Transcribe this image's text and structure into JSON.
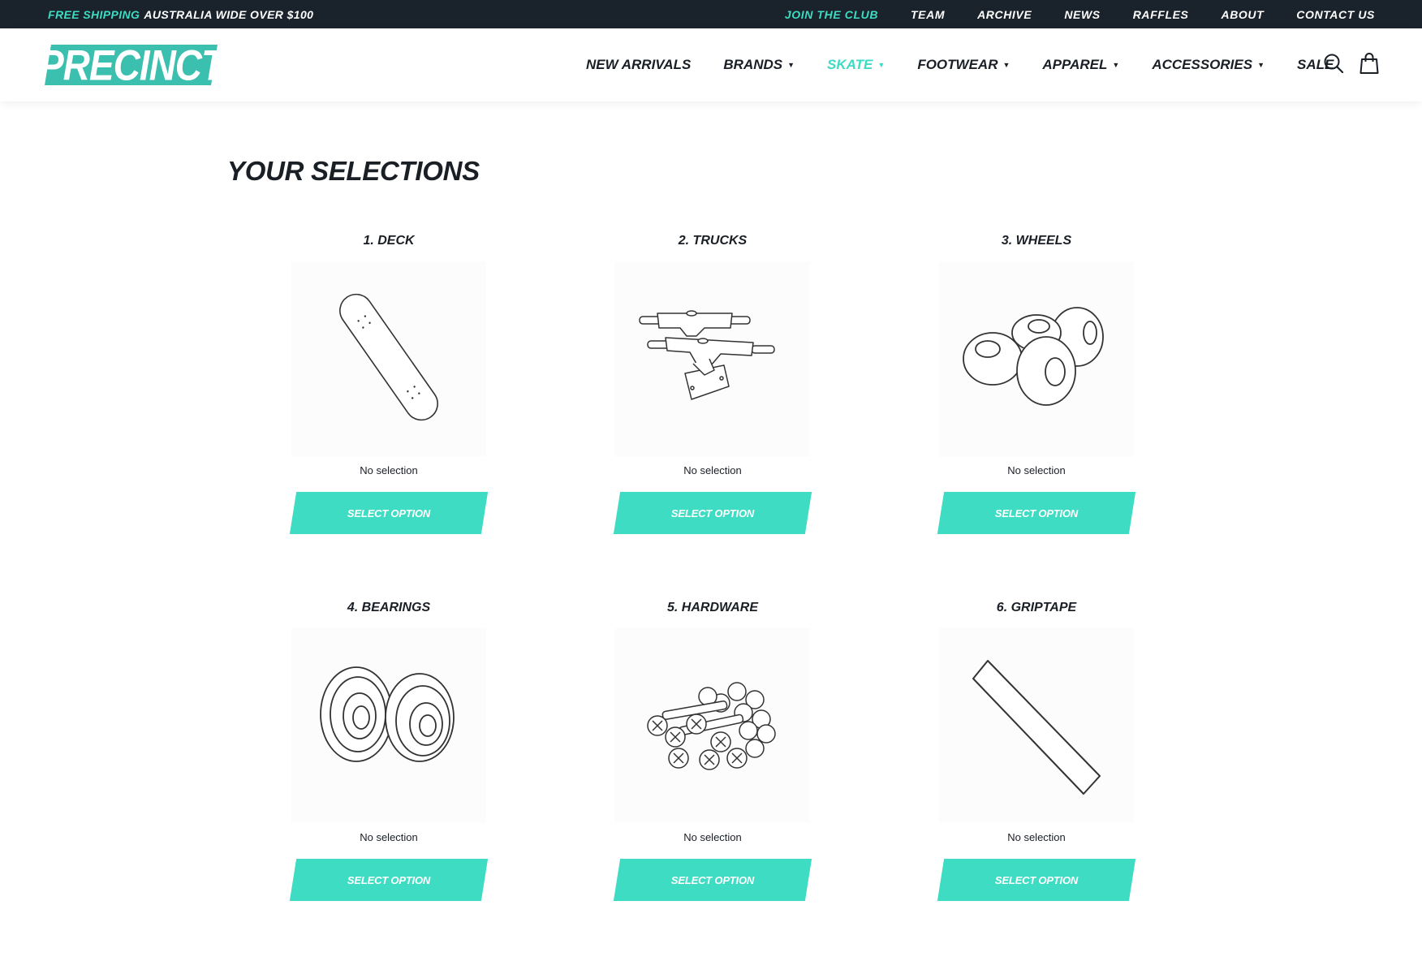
{
  "topbar": {
    "promo_accent": "FREE SHIPPING",
    "promo_text": "AUSTRALIA WIDE OVER $100",
    "links": [
      {
        "label": "JOIN THE CLUB"
      },
      {
        "label": "TEAM"
      },
      {
        "label": "ARCHIVE"
      },
      {
        "label": "NEWS"
      },
      {
        "label": "RAFFLES"
      },
      {
        "label": "ABOUT"
      },
      {
        "label": "CONTACT US"
      }
    ]
  },
  "header": {
    "logo": "PRECINCT",
    "nav": [
      {
        "label": "NEW ARRIVALS",
        "caret": ""
      },
      {
        "label": "BRANDS",
        "caret": "▼"
      },
      {
        "label": "SKATE",
        "caret": "▼"
      },
      {
        "label": "FOOTWEAR",
        "caret": "▼"
      },
      {
        "label": "APPAREL",
        "caret": "▼"
      },
      {
        "label": "ACCESSORIES",
        "caret": "▼"
      },
      {
        "label": "SALE",
        "caret": ""
      }
    ],
    "icons": [
      "search-icon",
      "shopping-bag-icon"
    ]
  },
  "main": {
    "title": "YOUR SELECTIONS",
    "cards": [
      {
        "title": "1. DECK",
        "status": "No selection",
        "button": "SELECT OPTION",
        "icon": "deck-icon"
      },
      {
        "title": "2. TRUCKS",
        "status": "No selection",
        "button": "SELECT OPTION",
        "icon": "trucks-icon"
      },
      {
        "title": "3. WHEELS",
        "status": "No selection",
        "button": "SELECT OPTION",
        "icon": "wheels-icon"
      },
      {
        "title": "4. BEARINGS",
        "status": "No selection",
        "button": "SELECT OPTION",
        "icon": "bearings-icon"
      },
      {
        "title": "5. HARDWARE",
        "status": "No selection",
        "button": "SELECT OPTION",
        "icon": "hardware-icon"
      },
      {
        "title": "6. GRIPTAPE",
        "status": "No selection",
        "button": "SELECT OPTION",
        "icon": "griptape-icon"
      }
    ]
  },
  "colors": {
    "accent": "#3ddcc3",
    "logo_bg": "#3bbfae",
    "topbar_bg": "#1a222b",
    "text": "#1a1f26"
  }
}
